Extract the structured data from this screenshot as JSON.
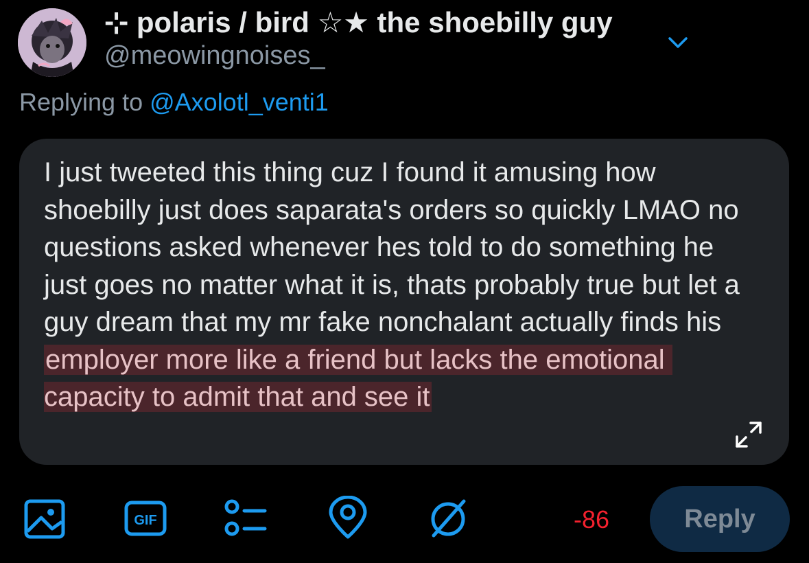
{
  "author": {
    "display_name": "⊹ polaris / bird ☆★ the shoebilly guy",
    "handle": "@meowingnoises_"
  },
  "reply_context": {
    "prefix": "Replying to ",
    "mention": "@Axolotl_venti1"
  },
  "compose": {
    "text_normal": "I just tweeted this thing cuz I found it amusing how shoebilly just does saparata's orders so quickly LMAO no questions asked whenever hes told to do something he just goes no matter what it is, thats probably true but let a guy dream that my mr fake nonchalant actually finds his",
    "text_over_limit": "employer more like a friend but lacks the emotional capacity to admit that and see it",
    "char_remaining": "-86"
  },
  "toolbar": {
    "icons": [
      "image-icon",
      "gif-icon",
      "poll-icon",
      "location-icon",
      "circle-slash-icon"
    ],
    "gif_label": "GIF",
    "reply_label": "Reply"
  },
  "colors": {
    "background": "#000000",
    "compose_box": "#202327",
    "accent": "#1d9bf0",
    "over_limit_highlight": "#4b252b",
    "counter_negative": "#f4212e",
    "reply_disabled_bg": "#0f2a44"
  }
}
